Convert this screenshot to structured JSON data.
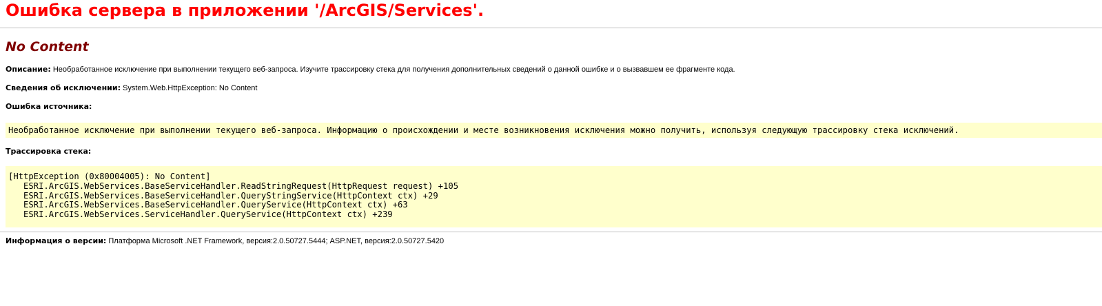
{
  "page": {
    "title": "Ошибка сервера в приложении '/ArcGIS/Services'.",
    "subtitle": "No Content",
    "description": {
      "label": "Описание:",
      "text": " Необработанное исключение при выполнении текущего веб-запроса. Изучите трассировку стека для получения дополнительных сведений о данной ошибке и о вызвавшем ее фрагменте кода."
    },
    "exception": {
      "label": "Сведения об исключении:",
      "text": " System.Web.HttpException: No Content"
    },
    "source_error": {
      "label": "Ошибка источника:",
      "text": "Необработанное исключение при выполнении текущего веб-запроса. Информацию о происхождении и месте возникновения исключения можно получить, используя следующую трассировку стека исключений."
    },
    "stack_trace": {
      "label": "Трассировка стека:",
      "lines": [
        "[HttpException (0x80004005): No Content]",
        "   ESRI.ArcGIS.WebServices.BaseServiceHandler.ReadStringRequest(HttpRequest request) +105",
        "   ESRI.ArcGIS.WebServices.BaseServiceHandler.QueryStringService(HttpContext ctx) +29",
        "   ESRI.ArcGIS.WebServices.BaseServiceHandler.QueryService(HttpContext ctx) +63",
        "   ESRI.ArcGIS.WebServices.ServiceHandler.QueryService(HttpContext ctx) +239"
      ]
    },
    "version": {
      "label": "Информация о версии:",
      "text": " Платформа Microsoft .NET Framework, версия:2.0.50727.5444; ASP.NET, версия:2.0.50727.5420"
    }
  },
  "colors": {
    "title": "#ff0000",
    "subtitle": "#800000",
    "code_background": "#ffffcc",
    "rule": "#bfbfbf"
  }
}
